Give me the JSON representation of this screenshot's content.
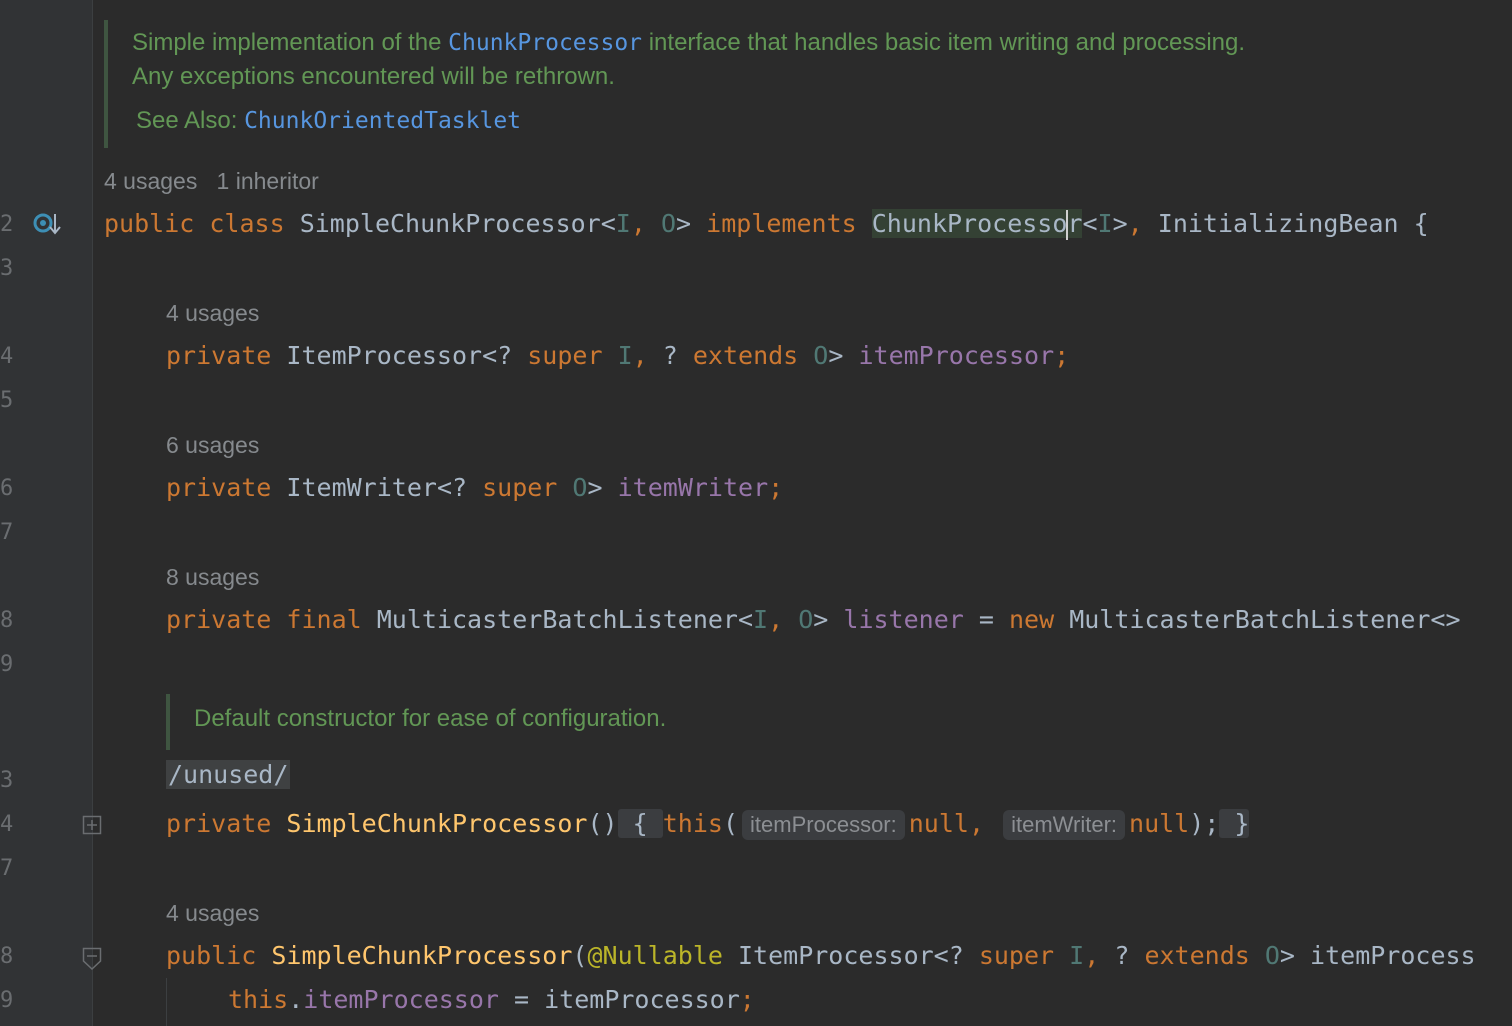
{
  "gutter": {
    "line_numbers": [
      "2",
      "3",
      "4",
      "5",
      "6",
      "7",
      "8",
      "9",
      "3",
      "4",
      "7",
      "8",
      "9"
    ]
  },
  "javadoc_class": {
    "line1_prefix": "Simple implementation of the ",
    "line1_link": "ChunkProcessor",
    "line1_suffix": " interface that handles basic item writing and processing.",
    "line2": "Any exceptions encountered will be rethrown.",
    "see_also_label": "See Also: ",
    "see_also_link": "ChunkOrientedTasklet"
  },
  "class_inlay": {
    "usages": "4 usages",
    "inheritors": "1 inheritor"
  },
  "class_decl": {
    "kw_public": "public",
    "kw_class": "class",
    "class_name": "SimpleChunkProcessor",
    "lt": "<",
    "type_i": "I",
    "comma": ", ",
    "type_o": "O",
    "gt": ">",
    "kw_implements": "implements",
    "iface1_part1": "ChunkProcesso",
    "iface1_part2": "r",
    "iface1_generic_open": "<",
    "iface1_type": "I",
    "iface1_generic_close": ">",
    "comma2": ", ",
    "iface2": "InitializingBean",
    "brace": "{"
  },
  "field1": {
    "usages": "4 usages",
    "kw_private": "private",
    "type": "ItemProcessor",
    "generic_open": "<? ",
    "kw_super": "super",
    "type_i": "I",
    "comma": ", ",
    "q": "? ",
    "kw_extends": "extends",
    "type_o": "O",
    "generic_close": ">",
    "name": "itemProcessor",
    "semi": ";"
  },
  "field2": {
    "usages": "6 usages",
    "kw_private": "private",
    "type": "ItemWriter",
    "generic_open": "<? ",
    "kw_super": "super",
    "type_o": "O",
    "generic_close": ">",
    "name": "itemWriter",
    "semi": ";"
  },
  "field3": {
    "usages": "8 usages",
    "kw_private": "private",
    "kw_final": "final",
    "type": "MulticasterBatchListener",
    "generic_open": "<",
    "type_i": "I",
    "comma": ", ",
    "type_o": "O",
    "generic_close": ">",
    "name": "listener",
    "eq": " = ",
    "kw_new": "new",
    "new_type": "MulticasterBatchListener<>"
  },
  "javadoc_ctor": {
    "text": "Default constructor for ease of configuration."
  },
  "unused_marker": "/unused/",
  "ctor1": {
    "kw_private": "private",
    "name": "SimpleChunkProcessor",
    "parens": "()",
    "brace_open": "{",
    "kw_this": "this",
    "paren_open": "(",
    "hint1": "itemProcessor:",
    "arg1": "null",
    "comma": ",",
    "hint2": "itemWriter:",
    "arg2": "null",
    "close": ");",
    "brace_close": "}"
  },
  "ctor2": {
    "usages": "4 usages",
    "kw_public": "public",
    "name": "SimpleChunkProcessor",
    "paren_open": "(",
    "annotation": "@Nullable",
    "type": "ItemProcessor",
    "generic_open": "<? ",
    "kw_super": "super",
    "type_i": "I",
    "comma": ", ",
    "q": "? ",
    "kw_extends": "extends",
    "type_o": "O",
    "generic_close": ">",
    "param_partial": "itemProcess"
  },
  "stmt": {
    "kw_this": "this",
    "dot": ".",
    "field": "itemProcessor",
    "eq": " = ",
    "value": "itemProcessor",
    "semi": ";"
  }
}
